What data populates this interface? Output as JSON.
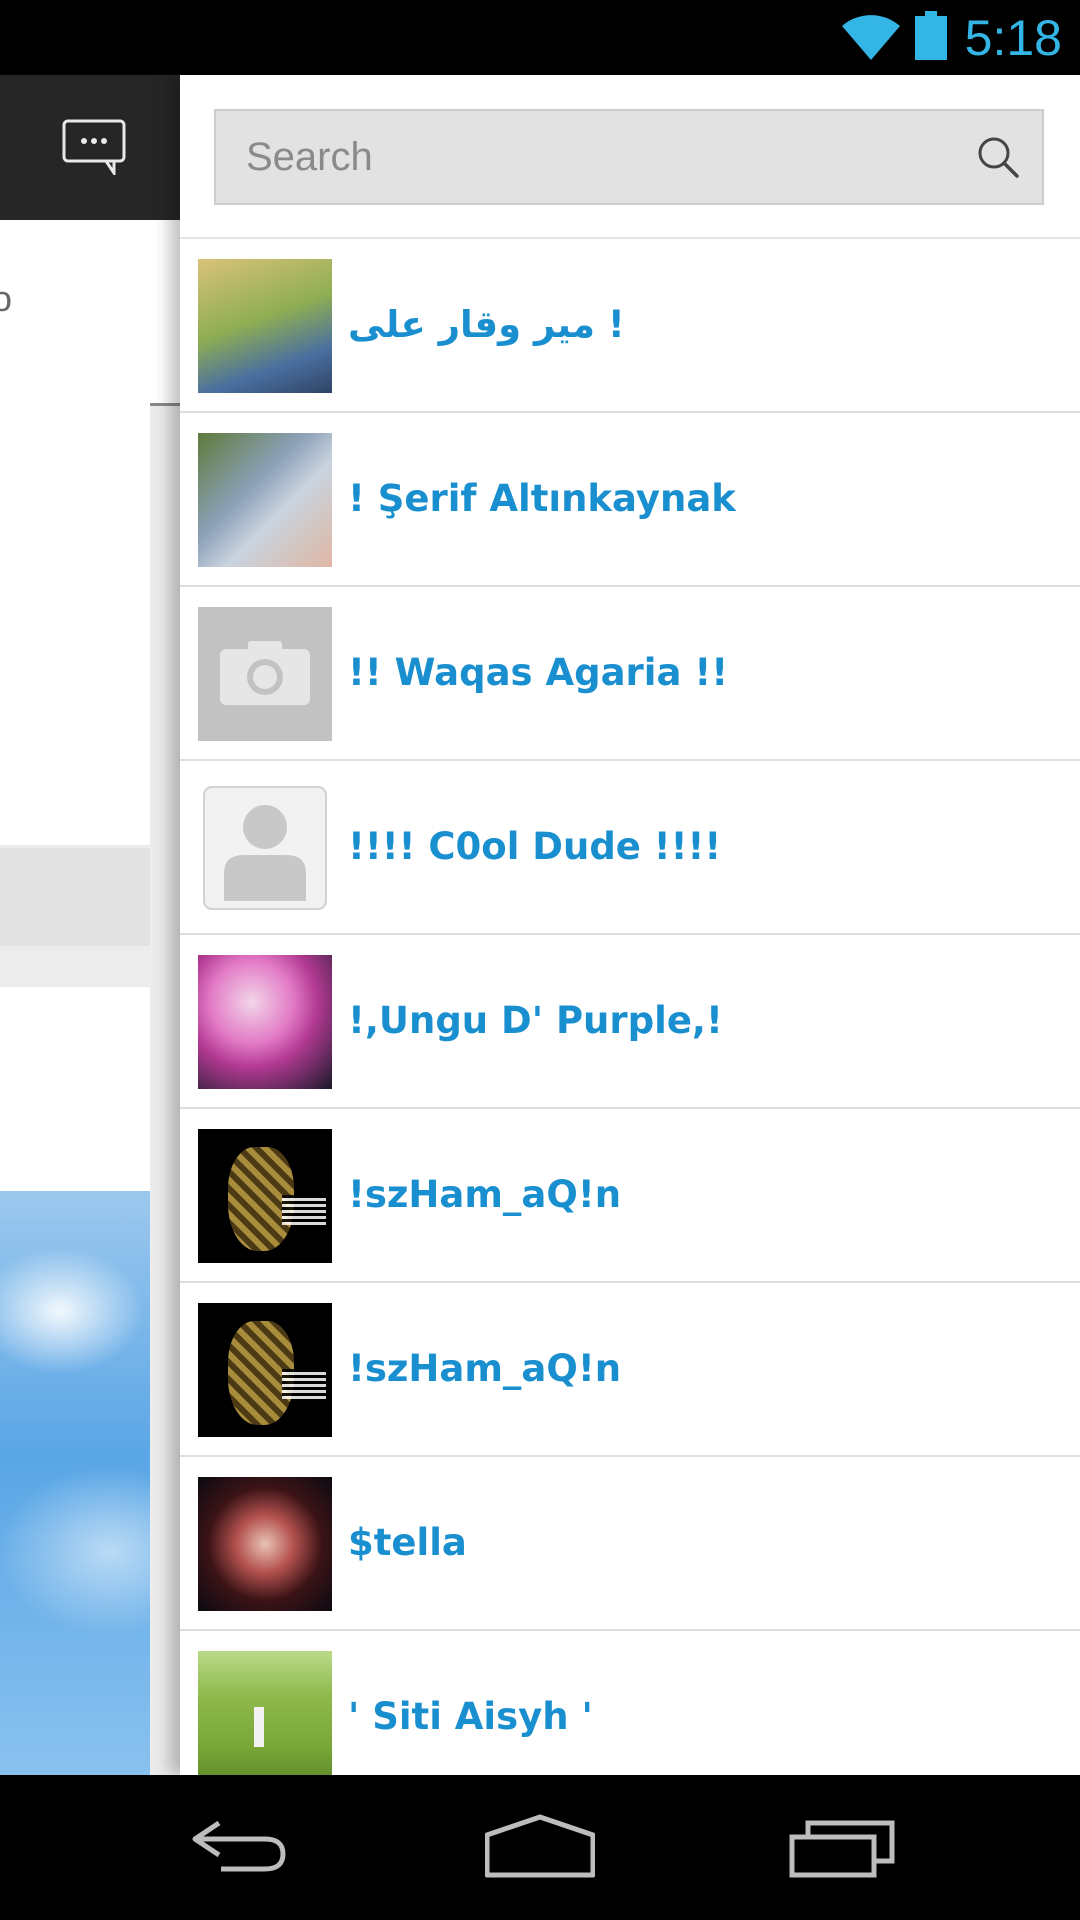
{
  "status_bar": {
    "time": "5:18",
    "icons": [
      "wifi-icon",
      "battery-icon"
    ],
    "accent_color": "#33b5e5"
  },
  "left_panel": {
    "header_icon": "chat-bubble-icon",
    "subbar_glyph": "o"
  },
  "search": {
    "placeholder": "Search",
    "value": "",
    "icon": "search-icon"
  },
  "contacts": [
    {
      "name": "میر وقار علی !",
      "avatar": "photo"
    },
    {
      "name": "! Şerif Altınkaynak",
      "avatar": "photo"
    },
    {
      "name": "!! Waqas Agaria !!",
      "avatar": "camera-placeholder"
    },
    {
      "name": "!!!! C0ol Dude !!!!",
      "avatar": "person-placeholder"
    },
    {
      "name": "!,Ungu D' Purple,!",
      "avatar": "photo"
    },
    {
      "name": "!szHam_aQ!n",
      "avatar": "photo"
    },
    {
      "name": "!szHam_aQ!n",
      "avatar": "photo"
    },
    {
      "name": "$tella",
      "avatar": "photo"
    },
    {
      "name": "' Siti Aisyh '",
      "avatar": "photo"
    }
  ],
  "nav_bar": {
    "buttons": [
      "back-icon",
      "home-icon",
      "recent-apps-icon"
    ]
  },
  "colors": {
    "contact_name": "#1a8fd0",
    "header_dark": "#262626"
  }
}
